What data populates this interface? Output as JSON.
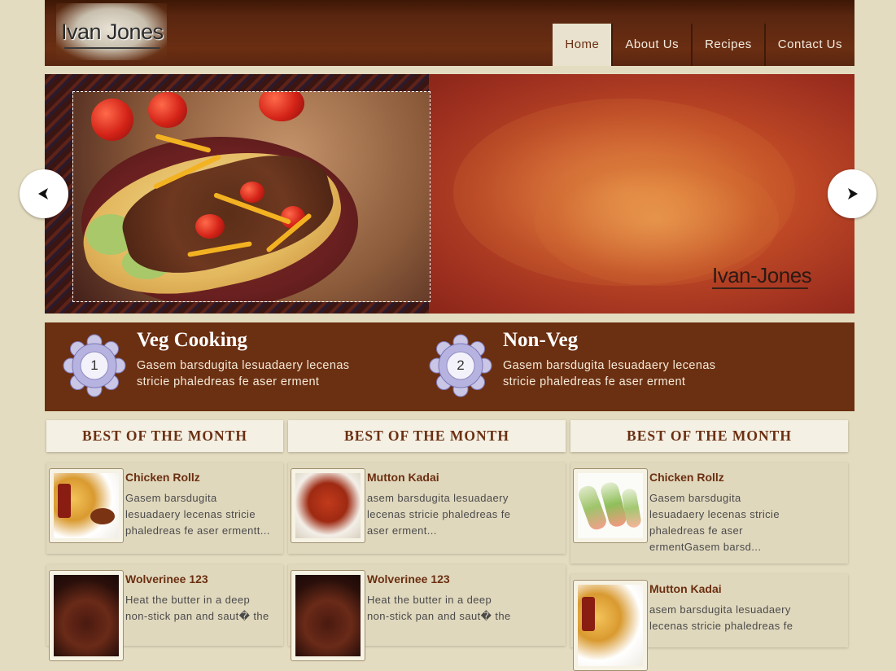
{
  "header": {
    "logo_text": "Ivan Jones",
    "nav": [
      "Home",
      "About Us",
      "Recipes",
      "Contact Us"
    ],
    "active_nav": "Home"
  },
  "slider": {
    "watermark": "Ivan-Jones",
    "prev_icon": "arrow-left-icon",
    "next_icon": "arrow-right-icon"
  },
  "features": [
    {
      "number": "1",
      "title": "Veg Cooking",
      "line1": "Gasem barsdugita lesuadaery lecenas",
      "line2": "stricie phaledreas fe aser erment"
    },
    {
      "number": "2",
      "title": "Non-Veg",
      "line1": "Gasem barsdugita lesuadaery lecenas",
      "line2": "stricie phaledreas fe aser erment"
    }
  ],
  "columns": [
    {
      "heading": "BEST OF THE MONTH",
      "cards": [
        {
          "title": "Chicken Rollz",
          "lines": [
            "Gasem barsdugita",
            "lesuadaery lecenas stricie",
            "phaledreas fe aser ermentt..."
          ]
        },
        {
          "title": "Wolverinee 123",
          "lines": [
            "Heat the butter in a deep",
            "non-stick pan and saut� the"
          ]
        }
      ]
    },
    {
      "heading": "BEST OF THE MONTH",
      "cards": [
        {
          "title": "Mutton Kadai",
          "lines": [
            "asem barsdugita lesuadaery",
            "lecenas stricie phaledreas fe",
            "aser erment..."
          ]
        },
        {
          "title": "Wolverinee 123",
          "lines": [
            "Heat the butter in a deep",
            "non-stick pan and saut� the"
          ]
        }
      ]
    },
    {
      "heading": "BEST OF THE MONTH",
      "cards": [
        {
          "title": "Chicken Rollz",
          "lines": [
            "Gasem barsdugita",
            "lesuadaery lecenas stricie",
            "phaledreas fe aser",
            "ermentGasem barsd..."
          ]
        },
        {
          "title": "Mutton Kadai",
          "lines": [
            "asem barsdugita lesuadaery",
            "lecenas stricie phaledreas fe"
          ]
        }
      ]
    }
  ],
  "colors": {
    "page_bg": "#e4dcc0",
    "brown": "#6b2f11",
    "header_dark": "#3d1705",
    "nav_active_bg": "#e8e2cf"
  }
}
